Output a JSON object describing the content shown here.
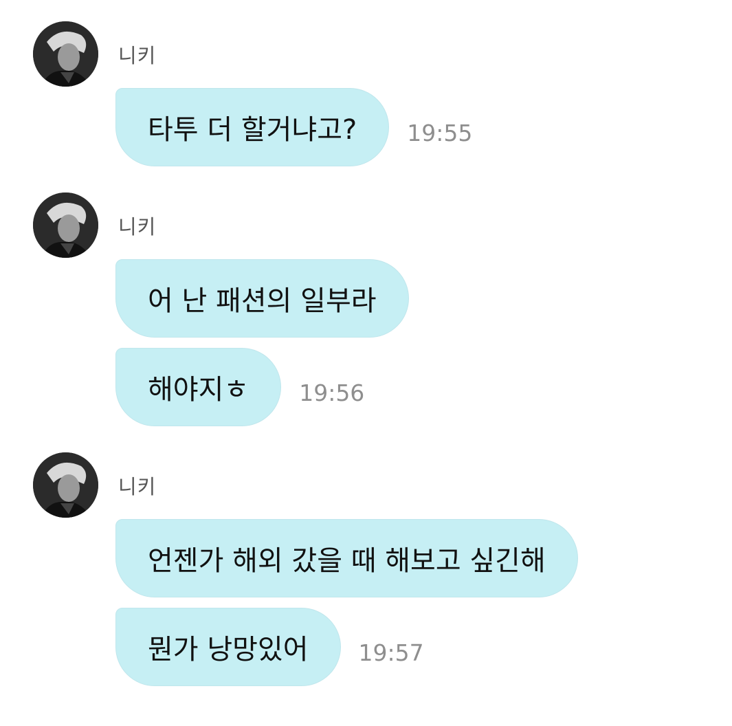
{
  "messages": [
    {
      "sender": "니키",
      "bubbles": [
        {
          "text": "타투 더 할거냐고?",
          "time": "19:55"
        }
      ]
    },
    {
      "sender": "니키",
      "bubbles": [
        {
          "text": "어 난 패션의 일부라",
          "time": ""
        },
        {
          "text": "해야지ㅎ",
          "time": "19:56"
        }
      ]
    },
    {
      "sender": "니키",
      "bubbles": [
        {
          "text": "언젠가 해외 갔을 때 해보고 싶긴해",
          "time": ""
        },
        {
          "text": "뭔가 낭망있어",
          "time": "19:57"
        }
      ]
    }
  ],
  "colors": {
    "bubble": "#c6eff4",
    "bubble_border": "#bfe6ec",
    "time": "#8e8e8e",
    "sender": "#555555"
  },
  "icons": {
    "avatar": "profile-photo-avatar"
  }
}
